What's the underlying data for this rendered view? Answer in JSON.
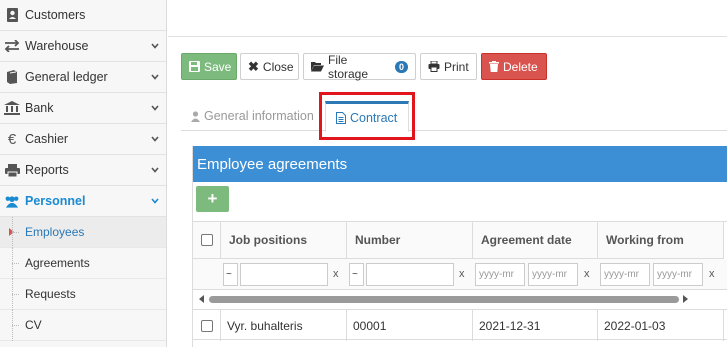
{
  "sidebar": {
    "items": [
      {
        "label": "Customers",
        "icon": "address-book-icon"
      },
      {
        "label": "Warehouse",
        "icon": "exchange-arrows-icon"
      },
      {
        "label": "General ledger",
        "icon": "book-icon"
      },
      {
        "label": "Bank",
        "icon": "bank-icon"
      },
      {
        "label": "Cashier",
        "icon": "euro-icon"
      },
      {
        "label": "Reports",
        "icon": "printer-icon"
      },
      {
        "label": "Personnel",
        "icon": "users-icon"
      }
    ],
    "subitems": [
      {
        "label": "Employees"
      },
      {
        "label": "Agreements"
      },
      {
        "label": "Requests"
      },
      {
        "label": "CV"
      }
    ]
  },
  "toolbar": {
    "save": "Save",
    "close": "Close",
    "file_storage": "File storage",
    "file_storage_count": "0",
    "print": "Print",
    "delete": "Delete"
  },
  "tabs": {
    "general": "General information",
    "contract": "Contract"
  },
  "panel": {
    "title": "Employee agreements",
    "add": "+"
  },
  "grid": {
    "columns": [
      "Job positions",
      "Number",
      "Agreement date",
      "Working from"
    ],
    "filter": {
      "tilde": "~",
      "clear": "x",
      "date_placeholder": "yyyy-mr"
    },
    "rows": [
      {
        "job_position": "Vyr. buhalteris",
        "number": "00001",
        "agreement_date": "2021-12-31",
        "working_from": "2022-01-03"
      }
    ]
  },
  "colors": {
    "accent": "#3c8fd5",
    "save": "#7dba7d",
    "delete": "#d9534f",
    "highlight": "#e0161c"
  }
}
